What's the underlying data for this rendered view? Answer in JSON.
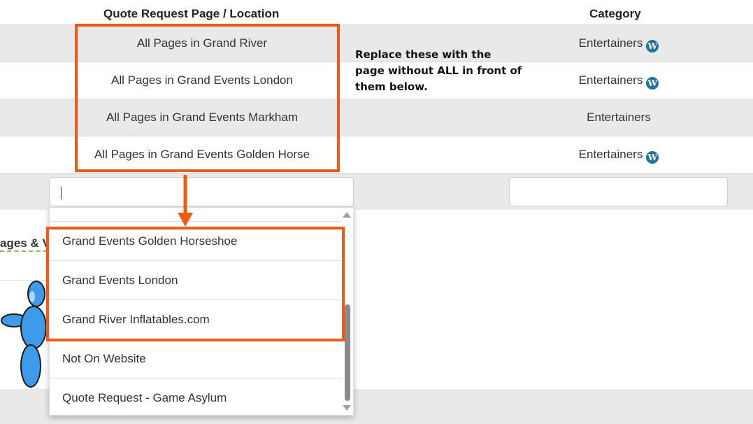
{
  "header": {
    "page_col": "Quote Request Page / Location",
    "category_col": "Category"
  },
  "rows": [
    {
      "page": "All Pages in Grand River",
      "category": "Entertainers",
      "wp_icon": true
    },
    {
      "page": "All Pages in Grand Events London",
      "category": "Entertainers",
      "wp_icon": true
    },
    {
      "page": "All Pages in Grand Events Markham",
      "category": "Entertainers",
      "wp_icon": false
    },
    {
      "page": "All Pages in Grand Events Golden Horse",
      "category": "Entertainers",
      "wp_icon": true
    }
  ],
  "filter": {
    "page_value": "",
    "category_value": ""
  },
  "dropdown": {
    "options": [
      "Grand Events Golden Horseshoe",
      "Grand Events London",
      "Grand River Inflatables.com",
      "Not On Website",
      "Quote Request - Game Asylum"
    ]
  },
  "annotation": {
    "note": "Replace these with the page without ALL in front of them below.",
    "accent_color": "#f05a14"
  },
  "background": {
    "partial_text": "ages & V"
  },
  "icons": {
    "wordpress": "W",
    "wordpress_color": "#21759b"
  }
}
